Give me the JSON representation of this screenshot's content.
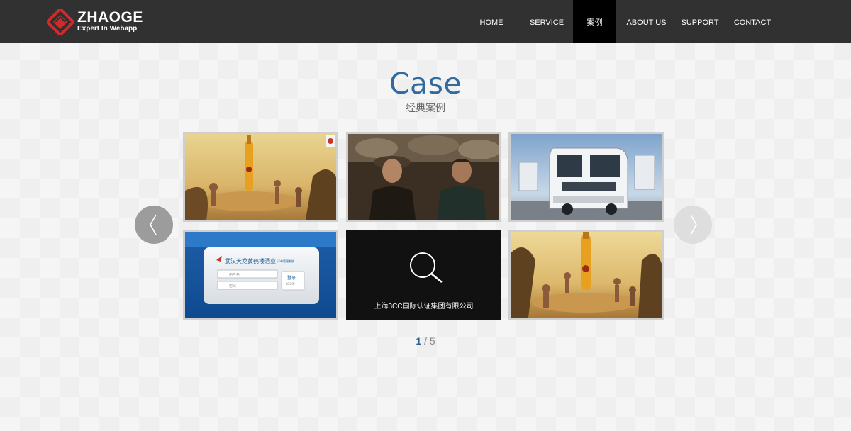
{
  "brand": {
    "name": "ZHAOGE",
    "tagline": "Expert In Webapp",
    "accent_color": "#d3292c"
  },
  "nav": {
    "items": [
      {
        "label": "HOME",
        "active": false
      },
      {
        "label": "SERVICE",
        "active": false
      },
      {
        "label": "案例",
        "active": true
      },
      {
        "label": "ABOUT US",
        "active": false
      },
      {
        "label": "SUPPORT",
        "active": false
      },
      {
        "label": "CONTACT",
        "active": false
      }
    ]
  },
  "section": {
    "title": "Case",
    "subtitle": "经典案例",
    "title_color": "#2f6aa3"
  },
  "cases": [
    {
      "image": "beach-bottle-ad"
    },
    {
      "image": "two-men-portrait"
    },
    {
      "image": "white-truck"
    },
    {
      "image": "login-panel",
      "login_title": "武汉天龙黄鹤楼酒业",
      "login_tag": "订单管理系统",
      "username_placeholder": "用户名",
      "password_placeholder": "密码",
      "login_button": "登录",
      "login_button_sub": "LOGIN"
    },
    {
      "image": "search-placeholder",
      "caption": "上海3CC国际认证集团有限公司",
      "icon": "search-icon"
    },
    {
      "image": "beach-bottle-ad"
    }
  ],
  "carousel": {
    "prev_icon": "chevron-left-icon",
    "next_icon": "chevron-right-icon"
  },
  "pager": {
    "current": "1",
    "separator": "/",
    "total": "5"
  }
}
